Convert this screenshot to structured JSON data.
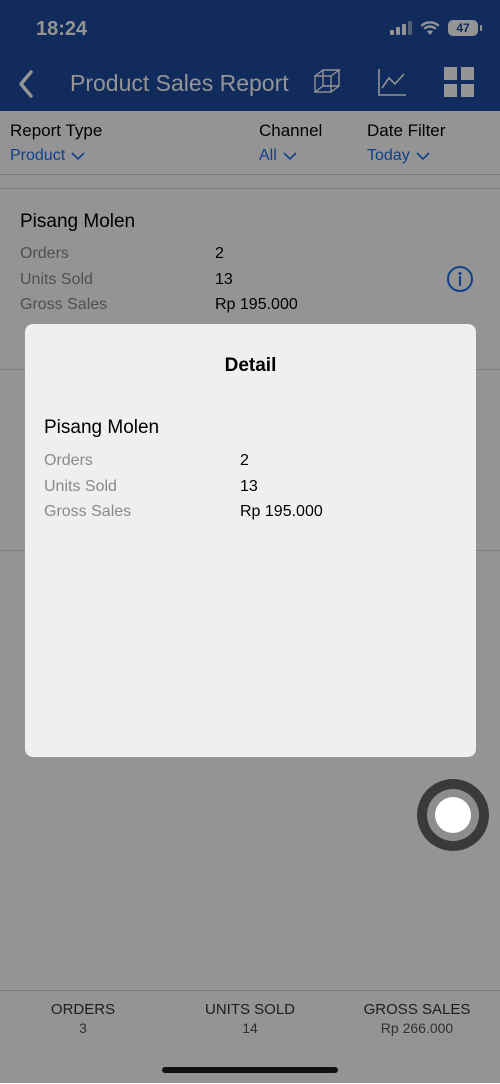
{
  "status": {
    "time": "18:24",
    "battery": "47"
  },
  "nav": {
    "title": "Product Sales Report"
  },
  "filters": {
    "report_type": {
      "label": "Report Type",
      "value": "Product"
    },
    "channel": {
      "label": "Channel",
      "value": "All"
    },
    "date_filter": {
      "label": "Date Filter",
      "value": "Today"
    }
  },
  "list": {
    "items": [
      {
        "name": "Pisang Molen",
        "orders_label": "Orders",
        "orders": "2",
        "units_label": "Units Sold",
        "units": "13",
        "gross_label": "Gross Sales",
        "gross": "Rp 195.000"
      }
    ]
  },
  "modal": {
    "title": "Detail",
    "name": "Pisang Molen",
    "orders_label": "Orders",
    "orders": "2",
    "units_label": "Units Sold",
    "units": "13",
    "gross_label": "Gross Sales",
    "gross": "Rp 195.000"
  },
  "footer": {
    "orders": {
      "label": "ORDERS",
      "value": "3"
    },
    "units": {
      "label": "UNITS SOLD",
      "value": "14"
    },
    "gross": {
      "label": "GROSS SALES",
      "value": "Rp 266.000"
    }
  },
  "colors": {
    "nav_bg": "#1e4ba0",
    "accent": "#1e6ff0"
  },
  "icons": [
    "back-chevron-icon",
    "cube-icon",
    "line-chart-icon",
    "grid-icon",
    "info-icon",
    "chevron-down-icon"
  ]
}
